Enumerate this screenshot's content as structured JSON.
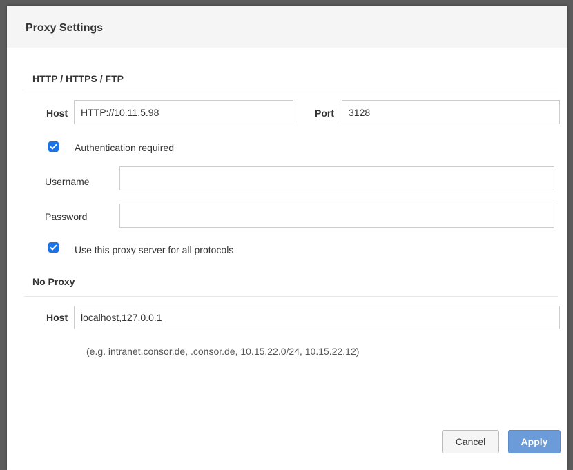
{
  "dialog": {
    "title": "Proxy Settings"
  },
  "http_section": {
    "title": "HTTP / HTTPS / FTP",
    "host_label": "Host",
    "host_value": "HTTP://10.11.5.98",
    "port_label": "Port",
    "port_value": "3128",
    "auth_checkbox": {
      "label": "Authentication required",
      "checked": true
    },
    "username_label": "Username",
    "username_value": "",
    "password_label": "Password",
    "password_value": "",
    "all_protocols_checkbox": {
      "label": "Use this proxy server for all protocols",
      "checked": true
    }
  },
  "no_proxy_section": {
    "title": "No Proxy",
    "host_label": "Host",
    "host_value": "localhost,127.0.0.1",
    "hint": "(e.g. intranet.consor.de, .consor.de, 10.15.22.0/24, 10.15.22.12)"
  },
  "buttons": {
    "cancel": "Cancel",
    "apply": "Apply"
  },
  "colors": {
    "checkbox": "#1a73e8",
    "apply_button": "#6b9bd8",
    "header_bg": "#f5f5f5"
  }
}
